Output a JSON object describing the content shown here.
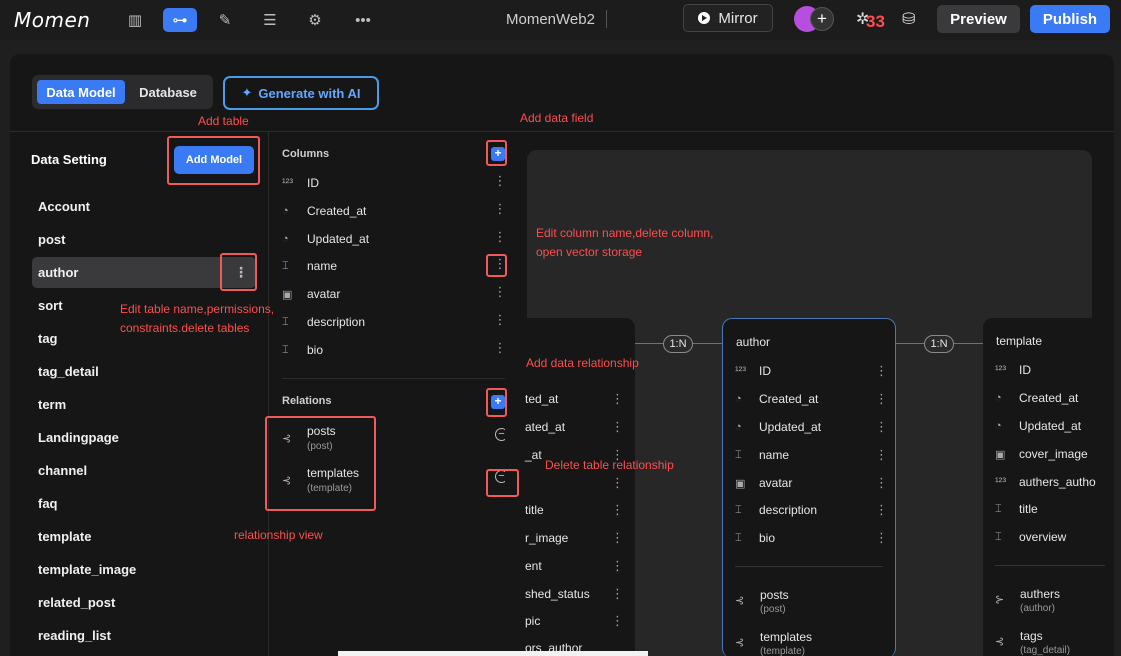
{
  "topbar": {
    "logo": "Momen",
    "project_name": "MomenWeb2",
    "mirror_label": "Mirror",
    "bug_count": "33",
    "preview_label": "Preview",
    "publish_label": "Publish",
    "avatar_add": "+",
    "icons": [
      "pages-icon",
      "data-model-icon",
      "actions-icon",
      "components-icon",
      "settings-icon",
      "more-icon"
    ]
  },
  "tabs": {
    "data_model": "Data Model",
    "database": "Database"
  },
  "generate_ai_label": "Generate with AI",
  "sidebar": {
    "title": "Data Setting",
    "add_model_label": "Add Model",
    "models": [
      "Account",
      "post",
      "author",
      "sort",
      "tag",
      "tag_detail",
      "term",
      "Landingpage",
      "channel",
      "faq",
      "template",
      "template_image",
      "related_post",
      "reading_list"
    ],
    "selected": "author"
  },
  "columns_panel": {
    "columns_label": "Columns",
    "columns": [
      {
        "name": "ID",
        "icon": "id-icon"
      },
      {
        "name": "Created_at",
        "icon": "clock-icon"
      },
      {
        "name": "Updated_at",
        "icon": "clock-icon"
      },
      {
        "name": "name",
        "icon": "text-icon"
      },
      {
        "name": "avatar",
        "icon": "image-icon"
      },
      {
        "name": "description",
        "icon": "text-icon"
      },
      {
        "name": "bio",
        "icon": "text-icon"
      }
    ],
    "relations_label": "Relations",
    "relations": [
      {
        "name": "posts",
        "target": "(post)"
      },
      {
        "name": "templates",
        "target": "(template)"
      }
    ]
  },
  "annotations": {
    "add_table": "Add table",
    "add_data_field": "Add data field",
    "edit_column": "Edit column name,delete column,",
    "edit_column_2": "open vector storage",
    "edit_table": "Edit table name,permissions,",
    "edit_table_2": "constraints.delete tables",
    "add_relationship": "Add data relationship",
    "delete_relationship": "Delete table relationship",
    "relationship_view": "relationship view"
  },
  "erd": {
    "post_partial_rows": [
      "ted_at",
      "ated_at",
      "_at",
      "",
      "title",
      "r_image",
      "ent",
      "shed_status",
      "pic",
      "ors_author"
    ],
    "connector_1": "1:N",
    "connector_2": "1:N",
    "author_card": {
      "title": "author",
      "columns": [
        "ID",
        "Created_at",
        "Updated_at",
        "name",
        "avatar",
        "description",
        "bio"
      ],
      "relations": [
        {
          "name": "posts",
          "target": "(post)"
        },
        {
          "name": "templates",
          "target": "(template)"
        }
      ]
    },
    "template_card": {
      "title": "template",
      "columns": [
        "ID",
        "Created_at",
        "Updated_at",
        "cover_image",
        "authers_autho",
        "title",
        "overview"
      ],
      "relations": [
        {
          "name": "authers",
          "target": "(author)"
        },
        {
          "name": "tags",
          "target": "(tag_detail)"
        }
      ]
    }
  }
}
